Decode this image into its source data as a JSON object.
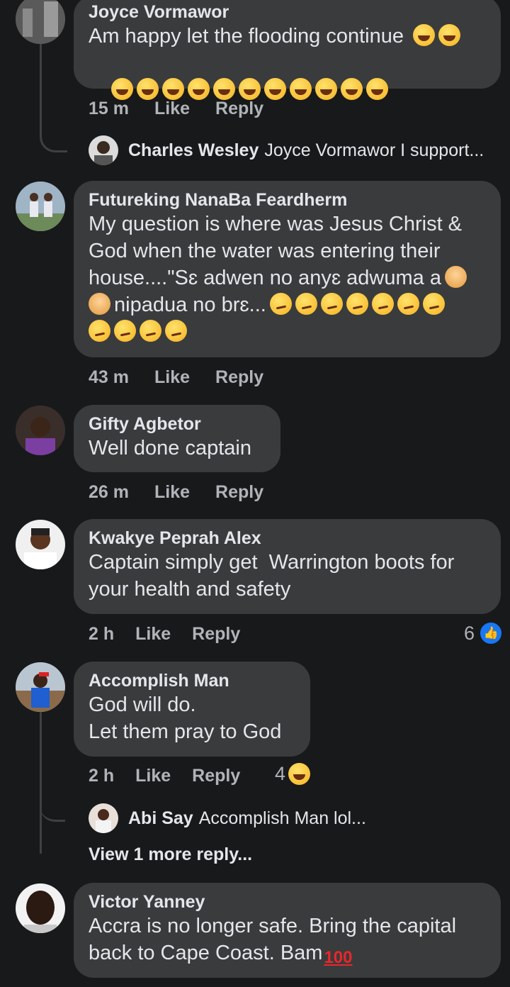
{
  "comments": [
    {
      "name": "Joyce Vormawor",
      "text": "Am happy let the flooding continue",
      "time": "15 m",
      "like": "Like",
      "reply": "Reply",
      "reply_preview": {
        "name": "Charles Wesley",
        "text": "Joyce Vormawor I support..."
      }
    },
    {
      "name": "Futureking NanaBa Feardherm",
      "text_lines": [
        "My question is where was Jesus Christ &",
        "God when the water was entering their",
        "house....\"Sɛ adwen no anyɛ adwuma a",
        "nipadua no brɛ..."
      ],
      "time": "43 m",
      "like": "Like",
      "reply": "Reply"
    },
    {
      "name": "Gifty Agbetor",
      "text": "Well done captain",
      "time": "26 m",
      "like": "Like",
      "reply": "Reply"
    },
    {
      "name": "Kwakye Peprah Alex",
      "text_lines": [
        "Captain simply get  Warrington boots for",
        "your health and safety"
      ],
      "time": "2 h",
      "like": "Like",
      "reply": "Reply",
      "reaction_count": "6",
      "reaction_icon": "thumbs-up-icon"
    },
    {
      "name": "Accomplish Man",
      "text_lines": [
        "God will do.",
        "Let them pray to God"
      ],
      "time": "2 h",
      "like": "Like",
      "reply": "Reply",
      "reaction_count": "4",
      "reaction_icon": "laughing-emoji-icon",
      "reply_preview": {
        "name": "Abi Say",
        "text": "Accomplish Man lol..."
      },
      "view_more": "View 1 more reply..."
    },
    {
      "name": "Victor Yanney",
      "text_lines": [
        "Accra is no longer safe. Bring the capital",
        "back to Cape Coast. Bam"
      ]
    }
  ],
  "colors": {
    "background": "#18191a",
    "bubble": "#3a3b3c",
    "text": "#e4e6eb",
    "meta": "#b0b3b8",
    "like_blue": "#1877f2"
  }
}
